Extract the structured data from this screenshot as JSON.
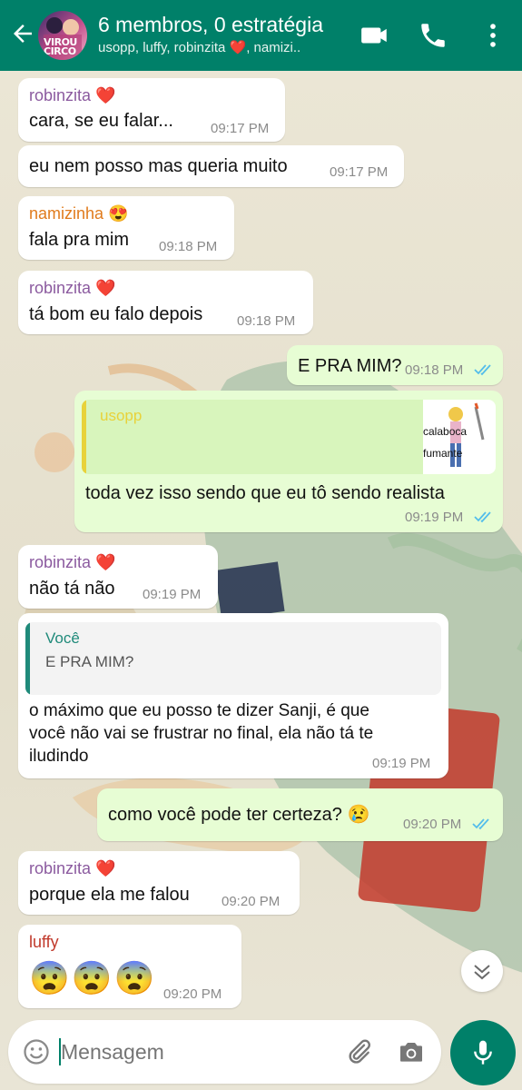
{
  "header": {
    "avatar_text_line1": "VIROU",
    "avatar_text_line2": "CIRCO",
    "title": "6 membros, 0 estratégia",
    "subtitle": "usopp, luffy, robinzita ❤️, namizi..",
    "icons": [
      "back-arrow-icon",
      "video-call-icon",
      "phone-icon",
      "more-options-icon"
    ]
  },
  "colors": {
    "header": "#008069",
    "incoming_bubble": "#ffffff",
    "outgoing_bubble": "#e7fdd4",
    "read_ticks": "#53bdeb",
    "robinzita": "#8b5a9f",
    "namizinha": "#e07b1d",
    "usopp": "#e8d23a",
    "luffy": "#c0392b",
    "voce": "#1f8a7a"
  },
  "messages": [
    {
      "sender": "robinzita ❤️",
      "text": "cara, se eu falar...",
      "time": "09:17 PM"
    },
    {
      "text": "eu nem posso mas queria muito",
      "time": "09:17 PM"
    },
    {
      "sender": "namizinha 😍",
      "text": "fala pra mim",
      "time": "09:18 PM"
    },
    {
      "sender": "robinzita ❤️",
      "text": "tá bom eu falo depois",
      "time": "09:18 PM"
    },
    {
      "out": true,
      "text": "E PRA MIM?",
      "time": "09:18 PM"
    },
    {
      "out": true,
      "quote_sender": "usopp",
      "sticker_text_1": "calaboca",
      "sticker_text_2": "fumante",
      "text": "toda vez isso sendo que eu tô sendo realista",
      "time": "09:19 PM"
    },
    {
      "sender": "robinzita ❤️",
      "text": "não tá não",
      "time": "09:19 PM"
    },
    {
      "quote_sender": "Você",
      "quote_text": "E PRA MIM?",
      "text_line1": "o máximo que eu posso te dizer Sanji, é que",
      "text_line2": "você não vai se frustrar no final, ela não tá te",
      "text_line3": "iludindo",
      "time": "09:19 PM"
    },
    {
      "out": true,
      "text": "como você pode ter certeza? 😢",
      "time": "09:20 PM"
    },
    {
      "sender": "robinzita ❤️",
      "text": "porque ela me falou",
      "time": "09:20 PM"
    },
    {
      "sender": "luffy",
      "text": "😨😨😨",
      "time": "09:20 PM"
    }
  ],
  "composer": {
    "placeholder": "Mensagem",
    "icons": [
      "emoji-icon",
      "attach-icon",
      "camera-icon",
      "mic-icon"
    ]
  }
}
